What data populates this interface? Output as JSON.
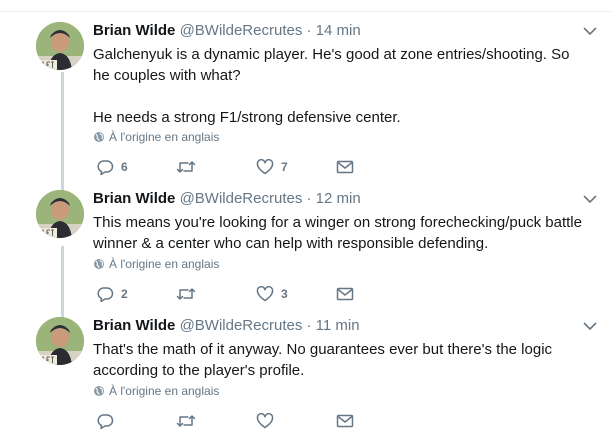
{
  "tweets": [
    {
      "name": "Brian Wilde",
      "handle": "@BWildeRecrutes",
      "separator": "·",
      "time": "14 min",
      "lines": [
        "Galchenyuk is a dynamic player. He's good at zone entries/shooting. So he couples with what?",
        "",
        "He needs a strong F1/strong defensive center."
      ],
      "translate": "À l'origine en anglais",
      "replies": "6",
      "retweets": "",
      "likes": "7"
    },
    {
      "name": "Brian Wilde",
      "handle": "@BWildeRecrutes",
      "separator": "·",
      "time": "12 min",
      "lines": [
        "This means you're looking for a winger on strong forechecking/puck battle winner & a center who can help with responsible defending."
      ],
      "translate": "À l'origine en anglais",
      "replies": "2",
      "retweets": "",
      "likes": "3"
    },
    {
      "name": "Brian Wilde",
      "handle": "@BWildeRecrutes",
      "separator": "·",
      "time": "11 min",
      "lines": [
        "That's the math of it anyway. No guarantees ever but there's the logic according to the player's profile."
      ],
      "translate": "À l'origine en anglais",
      "replies": "",
      "retweets": "",
      "likes": ""
    }
  ],
  "colors": {
    "text": "#14171a",
    "muted": "#657786",
    "thread_line": "#ccd6dd",
    "avatar_bg": "#9bb47a"
  },
  "icons": [
    "reply-icon",
    "retweet-icon",
    "like-icon",
    "message-icon",
    "globe-icon",
    "chevron-down-icon"
  ]
}
